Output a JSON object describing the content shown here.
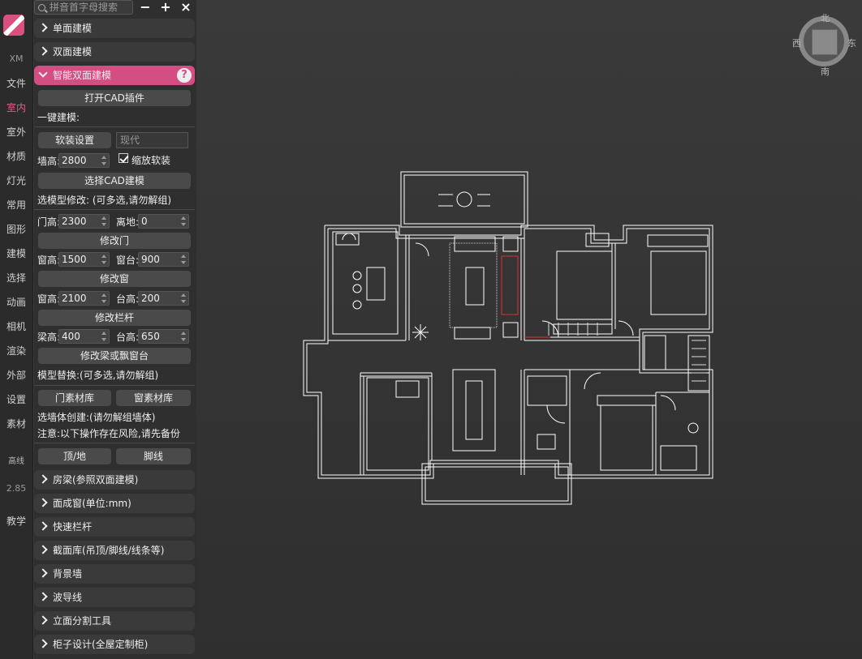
{
  "rail": {
    "items": [
      {
        "label": "XM",
        "kind": "dim"
      },
      {
        "label": "文件"
      },
      {
        "label": "室内",
        "active": true
      },
      {
        "label": "室外"
      },
      {
        "label": "材质"
      },
      {
        "label": "灯光"
      },
      {
        "label": "常用"
      },
      {
        "label": "图形"
      },
      {
        "label": "建模"
      },
      {
        "label": "选择"
      },
      {
        "label": "动画"
      },
      {
        "label": "相机"
      },
      {
        "label": "渲染"
      },
      {
        "label": "外部"
      },
      {
        "label": "设置"
      },
      {
        "label": "素材"
      },
      {
        "label": "高线",
        "kind": "small"
      },
      {
        "label": "2.85",
        "kind": "dim"
      },
      {
        "label": "教学"
      }
    ]
  },
  "toolbar": {
    "search_placeholder": "拼音首字母搜索",
    "minus": "−",
    "plus": "+",
    "close": "×"
  },
  "sections_top": [
    "单面建模",
    "双面建模",
    "智能双面建模"
  ],
  "smart": {
    "open_cad": "打开CAD插件",
    "one_click": "一键建模:",
    "soft_setting": "软装设置",
    "style_value": "现代",
    "wall_height_label": "墙高:",
    "wall_height": "2800",
    "scale_soft": "缩放软装",
    "select_cad": "选择CAD建模",
    "select_modify": "选模型修改: (可多选,请勿解组)",
    "door_height_label": "门高:",
    "door_height": "2300",
    "off_ground_label": "离地:",
    "off_ground": "0",
    "modify_door": "修改门",
    "win_height_label": "窗高:",
    "win_height": "1500",
    "sill_label": "窗台:",
    "sill": "900",
    "modify_window": "修改窗",
    "win_height2_label": "窗高:",
    "win_height2": "2100",
    "table_label": "台高:",
    "table_height": "200",
    "modify_rail": "修改栏杆",
    "beam_height_label": "梁高:",
    "beam_height": "400",
    "table2_label": "台高:",
    "table2_height": "650",
    "modify_beam": "修改梁或飘窗台",
    "model_replace": "模型替换:(可多选,请勿解组)",
    "door_lib": "门素材库",
    "window_lib": "窗素材库",
    "wall_create": "选墙体创建:(请勿解组墙体)",
    "warning": "注意:以下操作存在风险,请先备份",
    "ceiling_floor": "顶/地",
    "baseboard": "脚线"
  },
  "sections_bottom": [
    "房梁(参照双面建模)",
    "面成窗(单位:mm)",
    "快速栏杆",
    "截面库(吊顶/脚线/线条等)",
    "背景墙",
    "波导线",
    "立面分割工具",
    "柜子设计(全屋定制柜)"
  ],
  "compass": {
    "north": "北",
    "south": "南",
    "east": "东",
    "west": "西"
  },
  "colors": {
    "accent": "#d24e83",
    "rail": "#2b2b2b",
    "panel": "#2f2f2f",
    "lines": "#ffffff",
    "red": "#e03030"
  }
}
